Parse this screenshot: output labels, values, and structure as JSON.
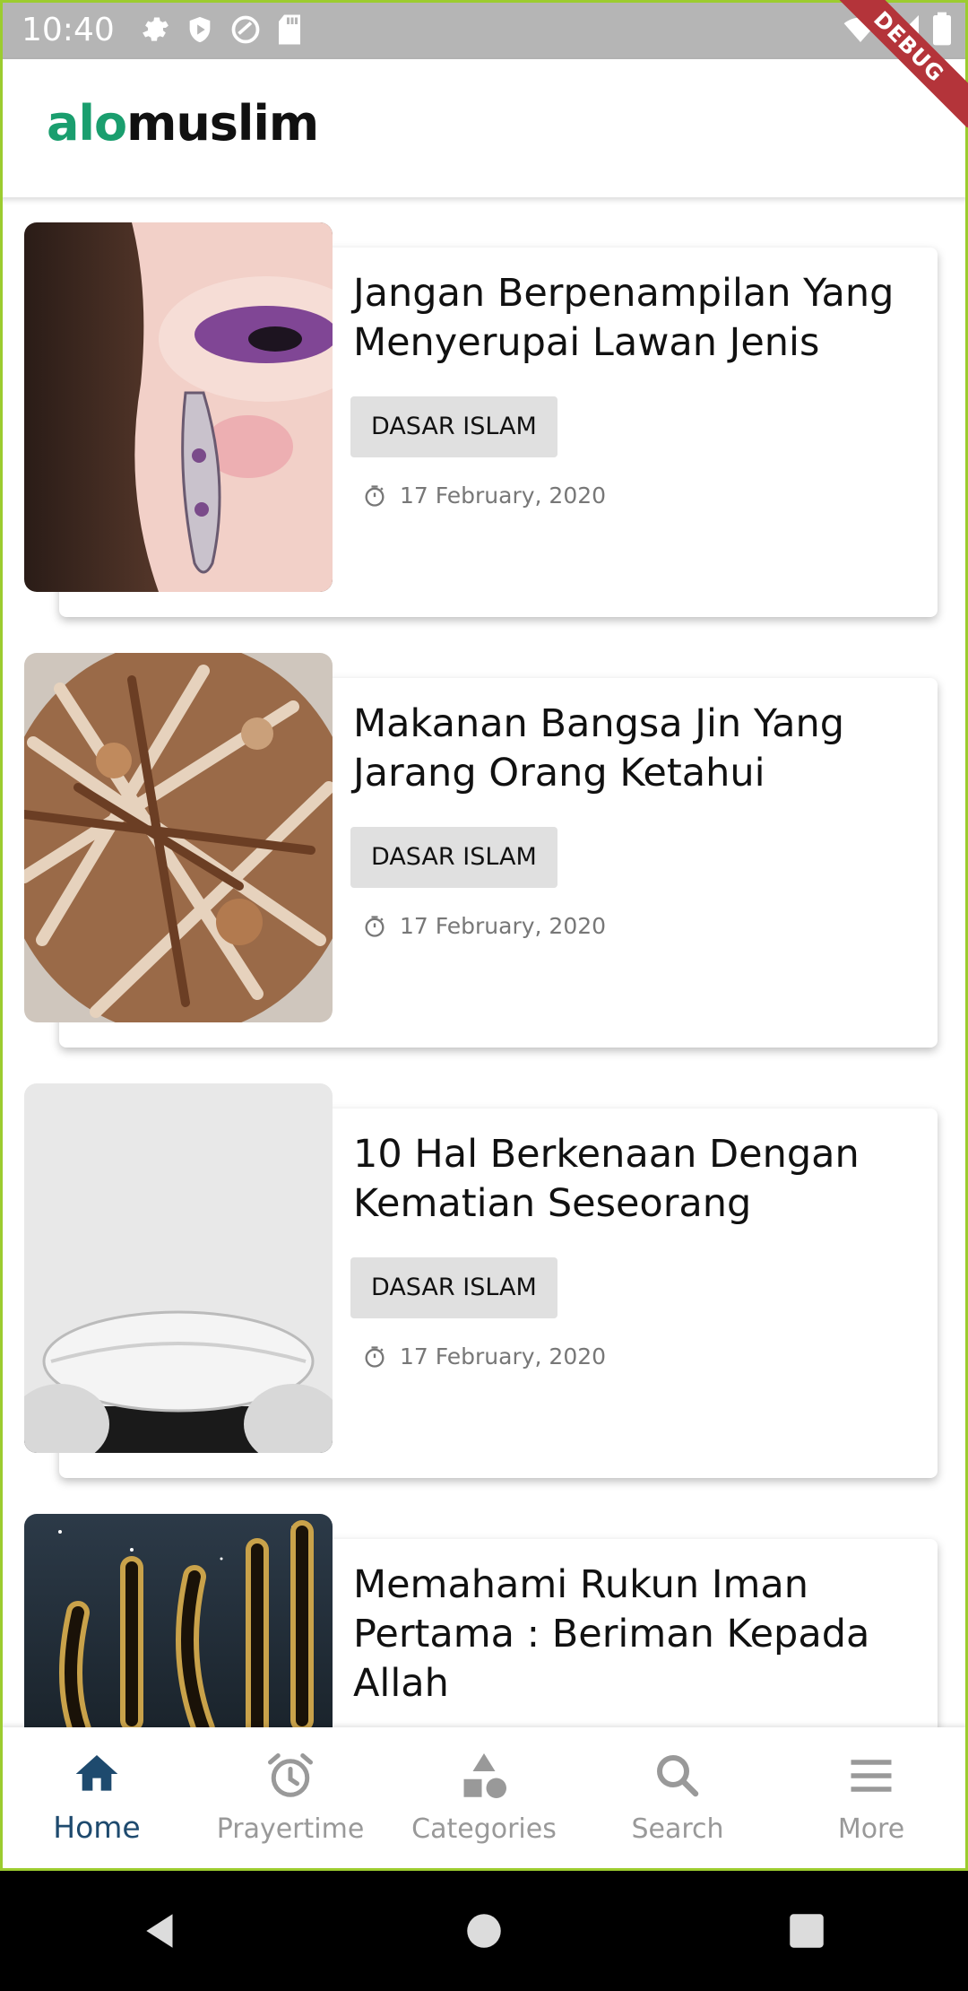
{
  "status_bar": {
    "time": "10:40",
    "debug_label": "DEBUG"
  },
  "app": {
    "logo_part1": "alo",
    "logo_part2": "muslim"
  },
  "articles": [
    {
      "title": "Jangan Berpenampilan Yang Menyerupai Lawan Jenis",
      "category": "DASAR ISLAM",
      "date": "17 February, 2020"
    },
    {
      "title": "Makanan Bangsa Jin Yang Jarang Orang Ketahui",
      "category": "DASAR ISLAM",
      "date": "17 February, 2020"
    },
    {
      "title": "10 Hal Berkenaan Dengan Kematian Seseorang",
      "category": "DASAR ISLAM",
      "date": "17 February, 2020"
    },
    {
      "title": "Memahami Rukun Iman Pertama : Beriman Kepada Allah",
      "category": "",
      "date": ""
    }
  ],
  "bottom_nav": {
    "items": [
      {
        "label": "Home",
        "icon": "home-icon",
        "active": true
      },
      {
        "label": "Prayertime",
        "icon": "alarm-clock-icon",
        "active": false
      },
      {
        "label": "Categories",
        "icon": "category-shapes-icon",
        "active": false
      },
      {
        "label": "Search",
        "icon": "search-icon",
        "active": false
      },
      {
        "label": "More",
        "icon": "menu-icon",
        "active": false
      }
    ]
  },
  "colors": {
    "brand_green": "#1a9e6e",
    "active_nav": "#1e4a6e",
    "inactive_nav": "#999999",
    "chip_bg": "#e0e0e0"
  }
}
